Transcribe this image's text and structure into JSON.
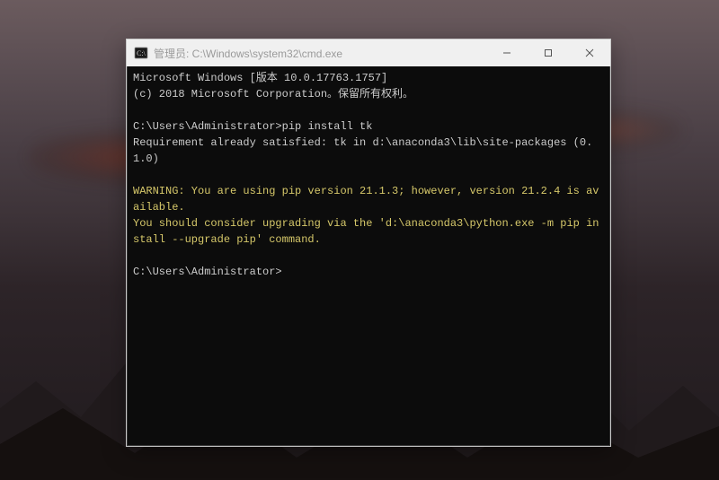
{
  "window": {
    "title": "管理员: C:\\Windows\\system32\\cmd.exe"
  },
  "terminal": {
    "banner_line1": "Microsoft Windows [版本 10.0.17763.1757]",
    "banner_line2": "(c) 2018 Microsoft Corporation。保留所有权利。",
    "prompt1_path": "C:\\Users\\Administrator>",
    "prompt1_cmd": "pip install tk",
    "output_line1": "Requirement already satisfied: tk in d:\\anaconda3\\lib\\site-packages (0.1.0)",
    "warning_line1": "WARNING: You are using pip version 21.1.3; however, version 21.2.4 is available.",
    "warning_line2": "You should consider upgrading via the 'd:\\anaconda3\\python.exe -m pip install --upgrade pip' command.",
    "prompt2_path": "C:\\Users\\Administrator>"
  }
}
